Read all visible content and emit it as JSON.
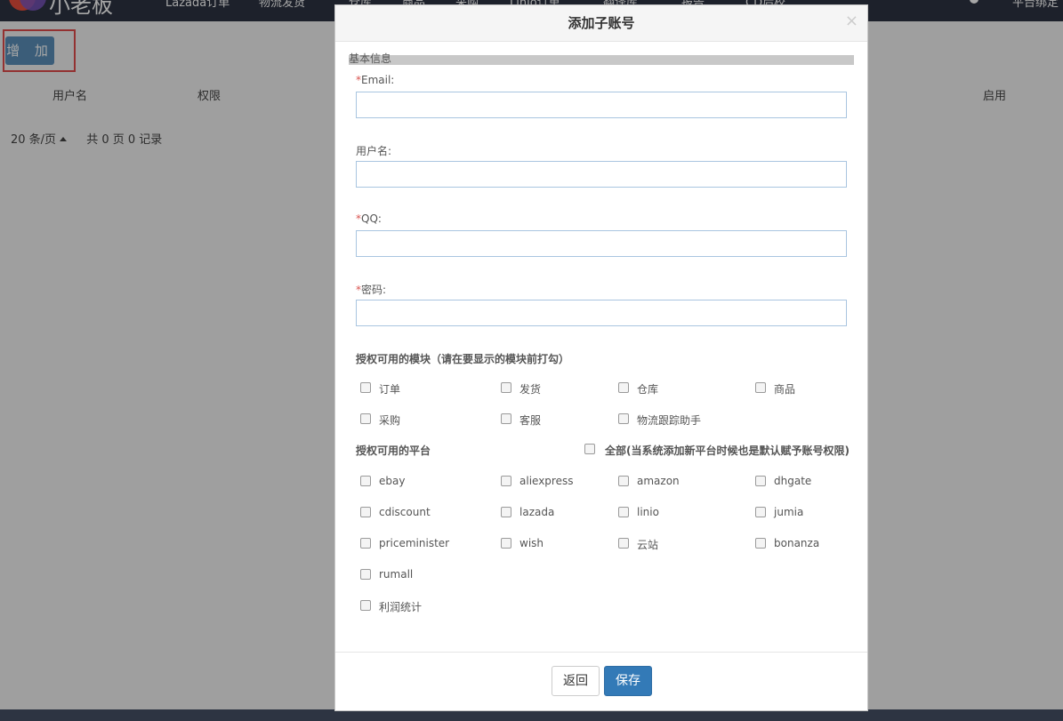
{
  "nav": {
    "logo_text": "小老板",
    "items": [
      "Lazada订单",
      "物流发货",
      "仓库",
      "商品",
      "采购",
      "Linio订单",
      "翻译库",
      "报告",
      "CD后校"
    ],
    "right_text": "平台绑定"
  },
  "page": {
    "add_button": "增 加",
    "col_username": "用户名",
    "col_permission": "权限",
    "col_enable": "启用",
    "page_size": "20 条/页",
    "pager_summary": "共 0 页 0 记录"
  },
  "modal": {
    "title": "添加子账号",
    "close": "×",
    "section": "基本信息",
    "required_mark": "*",
    "fields": {
      "email": "Email:",
      "username": "用户名:",
      "qq": "QQ:",
      "password": "密码:"
    },
    "modules_title": "授权可用的模块（请在要显示的模块前打勾）",
    "modules": [
      "订单",
      "发货",
      "仓库",
      "商品",
      "采购",
      "客服",
      "物流跟踪助手"
    ],
    "platforms_title": "授权可用的平台",
    "all_platforms": "全部(当系统添加新平台时候也是默认赋予账号权限)",
    "platforms": [
      "ebay",
      "aliexpress",
      "amazon",
      "dhgate",
      "cdiscount",
      "lazada",
      "linio",
      "jumia",
      "priceminister",
      "wish",
      "云站",
      "bonanza",
      "rumall",
      "利润统计"
    ],
    "back_button": "返回",
    "save_button": "保存"
  },
  "colors": {
    "nav_bg": "#2d3442",
    "add_button": "#5b8fba",
    "highlight": "#e24c4c",
    "save_button": "#337ab7",
    "required": "#d9534f"
  }
}
